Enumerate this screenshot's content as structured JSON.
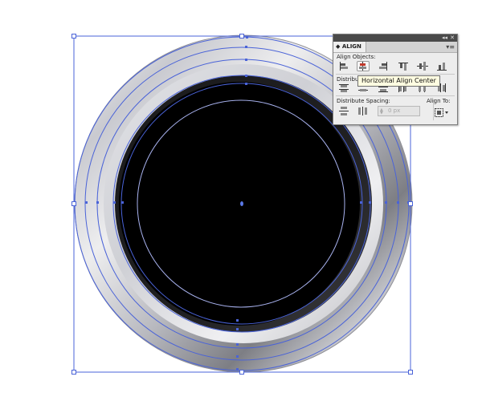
{
  "panel": {
    "tab_label": "◆ ALIGN",
    "collapse_glyph": "◂◂",
    "close_glyph": "✕",
    "menu_glyph": "▾≡",
    "align_objects_label": "Align Objects:",
    "distribute_objects_label": "Distribute Objects:",
    "distribute_spacing_label": "Distribute Spacing:",
    "align_to_label": "Align To:",
    "spacing_value": "0 px",
    "align_objects_buttons": [
      "horizontal-align-left",
      "horizontal-align-center",
      "horizontal-align-right",
      "vertical-align-top",
      "vertical-align-center",
      "vertical-align-bottom"
    ],
    "distribute_objects_buttons": [
      "vertical-distribute-top",
      "vertical-distribute-center",
      "vertical-distribute-bottom",
      "horizontal-distribute-left",
      "horizontal-distribute-center",
      "horizontal-distribute-right"
    ],
    "distribute_spacing_buttons": [
      "vertical-distribute-space",
      "horizontal-distribute-space"
    ]
  },
  "tooltip": {
    "text": "Horizontal Align Center"
  },
  "colors": {
    "selection": "#4a63d8",
    "panel_bg": "#ededed",
    "tooltip_bg": "#fffde1",
    "disc": "#000000"
  },
  "icons": {
    "align_to": "align-to-selection-icon"
  }
}
